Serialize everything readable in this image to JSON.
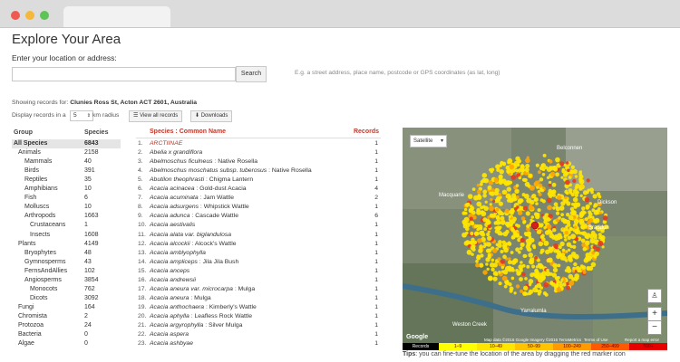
{
  "page": {
    "title": "Explore Your Area",
    "location_label": "Enter your location or address:"
  },
  "search": {
    "value": "",
    "button_label": "Search",
    "hint": "E.g. a street address, place name, postcode or GPS coordinates (as lat, long)"
  },
  "records": {
    "showing_prefix": "Showing records for:",
    "location": "Clunies Ross St, Acton ACT 2601, Australia",
    "display_label": "Display records in a",
    "radius": "5",
    "radius_unit": "km radius",
    "view_all_label": "View all records",
    "downloads_label": "Downloads"
  },
  "groups": {
    "headers": [
      "Group",
      "Species"
    ],
    "rows": [
      [
        "All Species",
        "6843"
      ],
      [
        "Animals",
        "2158"
      ],
      [
        "Mammals",
        "40"
      ],
      [
        "Birds",
        "391"
      ],
      [
        "Reptiles",
        "35"
      ],
      [
        "Amphibians",
        "10"
      ],
      [
        "Fish",
        "6"
      ],
      [
        "Molluscs",
        "10"
      ],
      [
        "Arthropods",
        "1663"
      ],
      [
        "Crustaceans",
        "1"
      ],
      [
        "Insects",
        "1608"
      ],
      [
        "Plants",
        "4149"
      ],
      [
        "Bryophytes",
        "48"
      ],
      [
        "Gymnosperms",
        "43"
      ],
      [
        "FernsAndAllies",
        "102"
      ],
      [
        "Angiosperms",
        "3854"
      ],
      [
        "Monocots",
        "762"
      ],
      [
        "Dicots",
        "3092"
      ],
      [
        "Fungi",
        "164"
      ],
      [
        "Chromista",
        "2"
      ],
      [
        "Protozoa",
        "24"
      ],
      [
        "Bacteria",
        "0"
      ],
      [
        "Algae",
        "0"
      ]
    ]
  },
  "species": {
    "header_species": "Species",
    "header_sep": ":",
    "header_common": "Common Name",
    "header_records": "Records",
    "rows": [
      [
        "1.",
        "ARCTIINAE",
        "",
        "1"
      ],
      [
        "2.",
        "Abelia x grandiflora",
        "",
        "1"
      ],
      [
        "3.",
        "Abelmoschus ficulneus",
        "Native Rosella",
        "1"
      ],
      [
        "4.",
        "Abelmoschus moschatus subsp. tuberosus",
        "Native Rosella",
        "1"
      ],
      [
        "5.",
        "Abutilon theophrasti",
        "Chigma Lantern",
        "1"
      ],
      [
        "6.",
        "Acacia acinacea",
        "Gold-dust Acacia",
        "4"
      ],
      [
        "7.",
        "Acacia acuminata",
        "Jam Wattle",
        "2"
      ],
      [
        "8.",
        "Acacia adsurgens",
        "Whipstick Wattle",
        "1"
      ],
      [
        "9.",
        "Acacia adunca",
        "Cascade Wattle",
        "6"
      ],
      [
        "10.",
        "Acacia aestivalis",
        "",
        "1"
      ],
      [
        "11.",
        "Acacia alata var. biglandulosa",
        "",
        "1"
      ],
      [
        "12.",
        "Acacia alcockii",
        "Alcock's Wattle",
        "1"
      ],
      [
        "13.",
        "Acacia amblyophylla",
        "",
        "1"
      ],
      [
        "14.",
        "Acacia ampliceps",
        "Jila Jila Bush",
        "1"
      ],
      [
        "15.",
        "Acacia anceps",
        "",
        "1"
      ],
      [
        "16.",
        "Acacia andrewsii",
        "",
        "1"
      ],
      [
        "17.",
        "Acacia aneura var. microcarpa",
        "Mulga",
        "1"
      ],
      [
        "18.",
        "Acacia aneura",
        "Mulga",
        "1"
      ],
      [
        "19.",
        "Acacia anthochaera",
        "Kimberly's Wattle",
        "1"
      ],
      [
        "20.",
        "Acacia aphylla",
        "Leafless Rock Wattle",
        "1"
      ],
      [
        "21.",
        "Acacia argyrophylla",
        "Silver Mulga",
        "1"
      ],
      [
        "22.",
        "Acacia aspera",
        "",
        "1"
      ],
      [
        "23.",
        "Acacia ashbyae",
        "",
        "1"
      ]
    ]
  },
  "map": {
    "type_select": "Satellite",
    "suburbs": [
      "Belconnen",
      "Macquarie",
      "Dickson",
      "Braddon",
      "Yarralumla",
      "Weston Creek"
    ],
    "attribution": "Map data ©2016 Google Imagery ©2016 TerraMetrics",
    "terms": "Terms of Use",
    "report": "Report a map error",
    "zoom_in": "+",
    "zoom_out": "−"
  },
  "legend": {
    "title": "Records",
    "bins": [
      "1–9",
      "10–49",
      "50–99",
      "100–249",
      "250–499",
      "500+"
    ],
    "colors": [
      "#ffff00",
      "#ffe500",
      "#ffc300",
      "#ff9a00",
      "#ff5a00",
      "#e60000"
    ]
  },
  "tips": {
    "label": "Tips",
    "text": ": you can fine-tune the location of the area by dragging the red marker icon"
  }
}
